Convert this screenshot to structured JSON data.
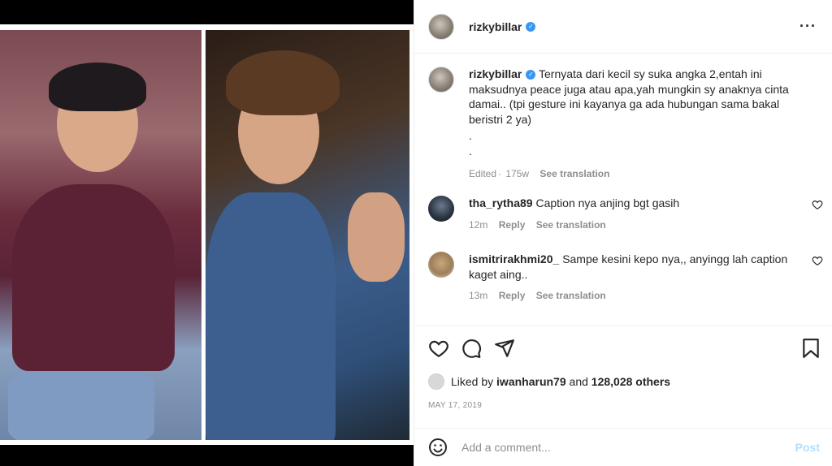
{
  "post": {
    "username": "rizkybillar",
    "caption": "Ternyata dari kecil sy suka angka 2,entah ini maksudnya peace juga atau apa,yah mungkin sy anaknya cinta damai.. (tpi gesture ini kayanya ga ada hubungan sama bakal beristri 2 ya)",
    "caption_dots": [
      ".",
      "."
    ],
    "edited": "Edited",
    "age": "175w",
    "see_translation": "See translation"
  },
  "comments": [
    {
      "username": "tha_rytha89",
      "text": "Caption nya anjing bgt gasih",
      "age": "12m",
      "reply": "Reply",
      "see_translation": "See translation"
    },
    {
      "username": "ismitrirakhmi20_",
      "text": "Sampe kesini kepo nya,, anyingg lah caption kaget aing..",
      "age": "13m",
      "reply": "Reply",
      "see_translation": "See translation"
    }
  ],
  "likes": {
    "prefix": "Liked by",
    "user": "iwanharun79",
    "and": "and",
    "count": "128,028 others"
  },
  "date": "MAY 17, 2019",
  "comment_box": {
    "placeholder": "Add a comment...",
    "post_label": "Post"
  },
  "colors": {
    "verified": "#3897f0",
    "post_disabled": "#b2dffc",
    "muted": "#8e8e8e"
  }
}
